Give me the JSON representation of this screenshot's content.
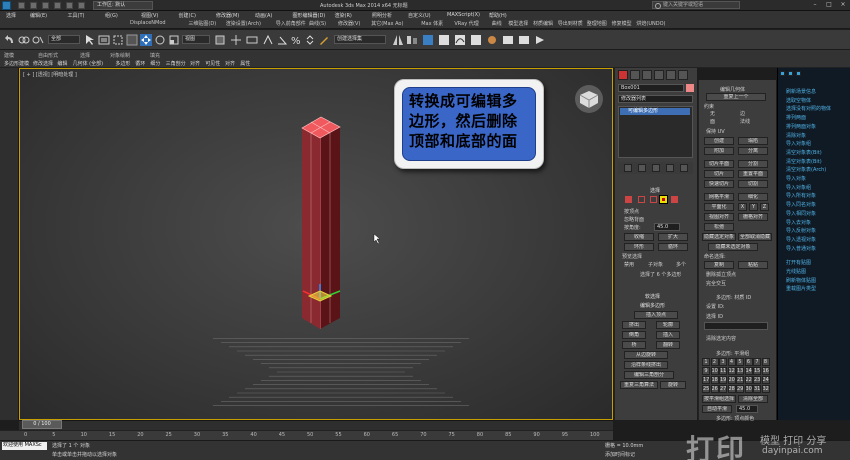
{
  "window": {
    "workspace": "工作区: 默认",
    "title": "Autodesk 3ds Max  2014 x64     无标题",
    "search_placeholder": "键入关键字或短语"
  },
  "menu": {
    "items": [
      "编辑(E)",
      "工具(T)",
      "组(G)",
      "视图(V)",
      "创建(C)",
      "修改器(M)",
      "动画(A)",
      "图形编辑器(D)",
      "渲染(R)",
      "照明分析",
      "自定义(U)",
      "MAXScript(X)",
      "帮助(H)"
    ],
    "sub_items": [
      "DisplaceNMod",
      "三维贴图(D)",
      "渲染设置(Arch)",
      "导入前角部件",
      "曲线(S)",
      "修改器(V)",
      "其它(Max Ao)",
      "Max 体素",
      "VRay 代理",
      "曲线",
      "模型选择",
      "材质编辑",
      "导出到材质",
      "整理地图",
      "修复模型",
      "烘焙(UNDO)"
    ],
    "left_label": "选择"
  },
  "toolbar": {
    "filter_value": "全部",
    "view_value": "视图",
    "selset_value": "创建选择集"
  },
  "ribbon": {
    "tabs": [
      "建模",
      "自由形式",
      "选择",
      "对象绘制",
      "填充"
    ],
    "commands": [
      "多边形建模",
      "修改选择",
      "编辑",
      "几何体 (全部)",
      "多边形",
      "循环",
      "细分",
      "三角剖分",
      "对齐",
      "可见性",
      "对齐",
      "属性"
    ]
  },
  "viewport": {
    "label": "[ + ] [透视] [明暗处理 ]",
    "callout_text": "转换成可编辑多边形，然后删除顶部和底部的面"
  },
  "command_panel": {
    "object_name": "Box001",
    "modifier_list": "修改器列表",
    "stack_item": "可编辑多边形",
    "rollout_selection": "选择",
    "by_vertex": "按顶点",
    "ignore_backfacing": "忽略背面",
    "by_angle": "按角度:",
    "angle_value": "45.0",
    "shrink": "收缩",
    "grow": "扩大",
    "ring": "环形",
    "loop": "循环",
    "preview": "预览选择",
    "disabled": "禁用",
    "subobject": "子对象",
    "multi": "多个",
    "status": "选择了 6 个多边形",
    "soft_selection": "软选择",
    "edit_polygons": "编辑多边形",
    "insert_vertex": "插入顶点",
    "extrude": "挤出",
    "outline": "轮廓",
    "bevel": "倒角",
    "inset": "插入",
    "bridge": "桥",
    "flip": "翻转",
    "hinge": "从边旋转",
    "extrude_spline": "沿样条线挤出",
    "edit_tri": "编辑三角剖分",
    "retriangulate": "重复三角算法",
    "turn": "旋转"
  },
  "edit_geometry": {
    "title": "编辑几何体",
    "repeat": "重复上一个",
    "constraints": "约束",
    "none": "无",
    "edge": "边",
    "face": "面",
    "normal": "法线",
    "preserve_uvs": "保持 UV",
    "create": "创建",
    "collapse": "塌陷",
    "attach": "附加",
    "detach": "分离",
    "slice_plane": "切片平面",
    "split": "分割",
    "slice": "切片",
    "reset_plane": "重置平面",
    "quickslice": "快速切片",
    "cut": "切割",
    "meshsmooth": "网格平滑",
    "tessellate": "细化",
    "make_planar": "平面化",
    "x": "X",
    "y": "Y",
    "z": "Z",
    "view_align": "视图对齐",
    "grid_align": "栅格对齐",
    "relax": "松弛",
    "hide_sel": "隐藏选定对象",
    "unhide_all": "全部取消隐藏",
    "hide_unsel": "隐藏未选定对象",
    "named_sel": "命名选择:",
    "copy": "复制",
    "paste": "粘贴",
    "delete_isolated": "删除孤立顶点",
    "full_interactivity": "完全交互",
    "material_ids": "多边形: 材质 ID",
    "set_id": "设置 ID:",
    "select_id": "选择 ID",
    "clear_sel": "清除选定内容",
    "smoothing_groups": "多边形: 平滑组",
    "select_by_sg": "按平滑组选择",
    "clear_all": "清除全部",
    "auto_smooth": "自动平滑",
    "auto_value": "45.0",
    "vertex_colors": "多边形: 顶点颜色"
  },
  "script_panel": {
    "items": [
      "刷新场景信息",
      "选取空物体",
      "选择没有对照的物体",
      "排列两面",
      "排列两面对象",
      "清除对象",
      "导入对象组",
      "清空对象表(Bit)",
      "清空对象表(Bit)",
      "清空对象表(Arch)",
      "导入对象",
      "导入对象组",
      "导入所有对象",
      "导入同名对象",
      "导入相同对象",
      "导入去对象",
      "导入反射对象",
      "导入透视对象",
      "导入普通对象",
      "打开有贴图",
      "光线贴图",
      "刷新物体贴图",
      "重载图片类型"
    ]
  },
  "timeline": {
    "frame": "0 / 100",
    "ticks": [
      "0",
      "5",
      "10",
      "15",
      "20",
      "25",
      "30",
      "35",
      "40",
      "45",
      "50",
      "55",
      "60",
      "65",
      "70",
      "75",
      "80",
      "85",
      "90",
      "95",
      "100"
    ]
  },
  "status": {
    "welcome": "欢迎使用 MAXSc",
    "line1": "选择了 1 个 对象",
    "line2": "单击或单击并拖动以选择对象",
    "grid": "栅格 = 10.0mm",
    "add_time_tag": "添加时间标记"
  },
  "watermark": {
    "logo_text": "打印",
    "tagline": "模型 打印 分享",
    "url": "dayinpai.com"
  }
}
